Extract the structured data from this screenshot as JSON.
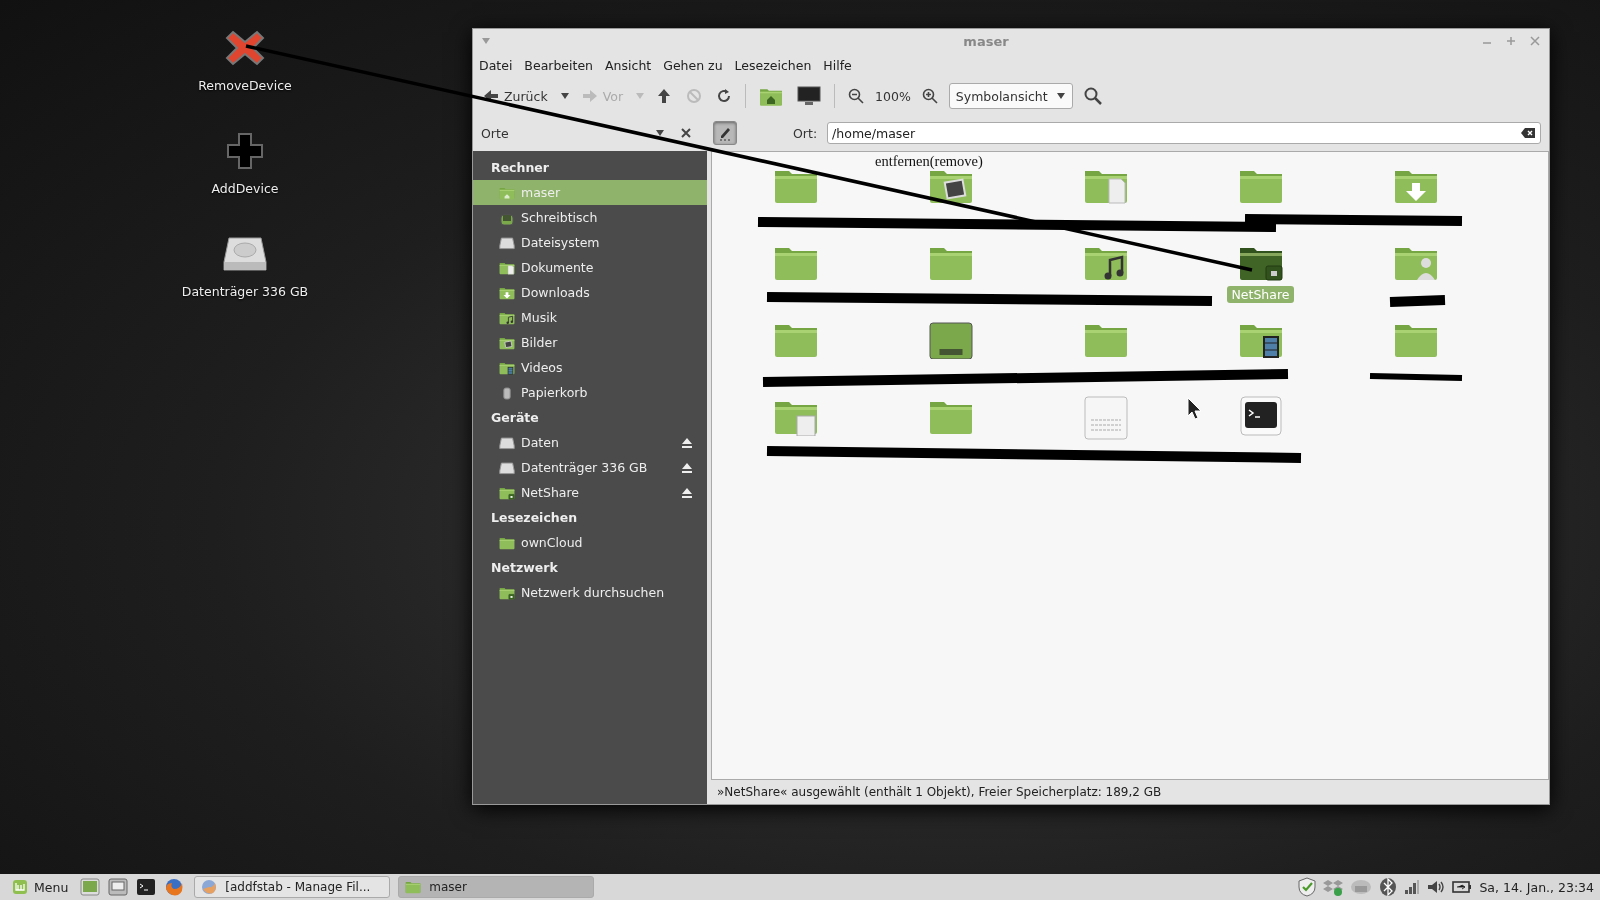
{
  "desktop": {
    "icons": [
      {
        "kind": "remove",
        "label": "RemoveDevice"
      },
      {
        "kind": "add",
        "label": "AddDevice"
      },
      {
        "kind": "disk",
        "label": "Datenträger 336 GB"
      }
    ]
  },
  "window": {
    "title": "maser",
    "menu": [
      "Datei",
      "Bearbeiten",
      "Ansicht",
      "Gehen zu",
      "Lesezeichen",
      "Hilfe"
    ],
    "toolbar": {
      "back": "Zurück",
      "forward": "Vor",
      "forward_disabled": true,
      "zoom": "100%",
      "view": "Symbolansicht"
    },
    "location": {
      "places": "Orte",
      "toggle_on": true,
      "label": "Ort:",
      "value": "/home/maser"
    },
    "sidebar": [
      {
        "heading": "Rechner",
        "items": [
          {
            "kind": "home",
            "label": "maser",
            "selected": true,
            "eject": false
          },
          {
            "kind": "desktop",
            "label": "Schreibtisch",
            "selected": false,
            "eject": false
          },
          {
            "kind": "disk",
            "label": "Dateisystem",
            "selected": false,
            "eject": false
          },
          {
            "kind": "documents",
            "label": "Dokumente",
            "selected": false,
            "eject": false
          },
          {
            "kind": "download",
            "label": "Downloads",
            "selected": false,
            "eject": false
          },
          {
            "kind": "music",
            "label": "Musik",
            "selected": false,
            "eject": false
          },
          {
            "kind": "pictures",
            "label": "Bilder",
            "selected": false,
            "eject": false
          },
          {
            "kind": "video",
            "label": "Videos",
            "selected": false,
            "eject": false
          },
          {
            "kind": "trash",
            "label": "Papierkorb",
            "selected": false,
            "eject": false
          }
        ]
      },
      {
        "heading": "Geräte",
        "items": [
          {
            "kind": "disk",
            "label": "Daten",
            "selected": false,
            "eject": true
          },
          {
            "kind": "disk",
            "label": "Datenträger 336 GB",
            "selected": false,
            "eject": true
          },
          {
            "kind": "share",
            "label": "NetShare",
            "selected": false,
            "eject": true
          }
        ]
      },
      {
        "heading": "Lesezeichen",
        "items": [
          {
            "kind": "folder",
            "label": "ownCloud",
            "selected": false,
            "eject": false
          }
        ]
      },
      {
        "heading": "Netzwerk",
        "items": [
          {
            "kind": "share",
            "label": "Netzwerk durchsuchen",
            "selected": false,
            "eject": false
          }
        ]
      }
    ],
    "files": [
      {
        "kind": "folder",
        "selected": false
      },
      {
        "kind": "pictures",
        "selected": false
      },
      {
        "kind": "documents",
        "selected": false
      },
      {
        "kind": "folder",
        "selected": false
      },
      {
        "kind": "download",
        "selected": false
      },
      {
        "kind": "folder",
        "selected": false
      },
      {
        "kind": "folder",
        "selected": false
      },
      {
        "kind": "music",
        "selected": false
      },
      {
        "kind": "share",
        "label": "NetShare",
        "selected": true
      },
      {
        "kind": "user",
        "selected": false
      },
      {
        "kind": "folder",
        "selected": false
      },
      {
        "kind": "desktop",
        "selected": false
      },
      {
        "kind": "folder",
        "selected": false
      },
      {
        "kind": "video",
        "selected": false
      },
      {
        "kind": "folder",
        "selected": false
      },
      {
        "kind": "template",
        "selected": false
      },
      {
        "kind": "folder",
        "selected": false
      },
      {
        "kind": "text",
        "selected": false
      },
      {
        "kind": "terminal",
        "selected": false
      }
    ],
    "annotation": "entfernen(remove)",
    "status_bar": "»NetShare« ausgewählt (enthält 1 Objekt), Freier Speicherplatz: 189,2 GB"
  },
  "taskbar": {
    "menu": "Menu",
    "windows": [
      {
        "kind": "browser",
        "label": "[addfstab - Manage Fil...",
        "selected": false
      },
      {
        "kind": "files",
        "label": "maser",
        "selected": true
      }
    ],
    "clock": "Sa, 14. Jan., 23:34"
  }
}
